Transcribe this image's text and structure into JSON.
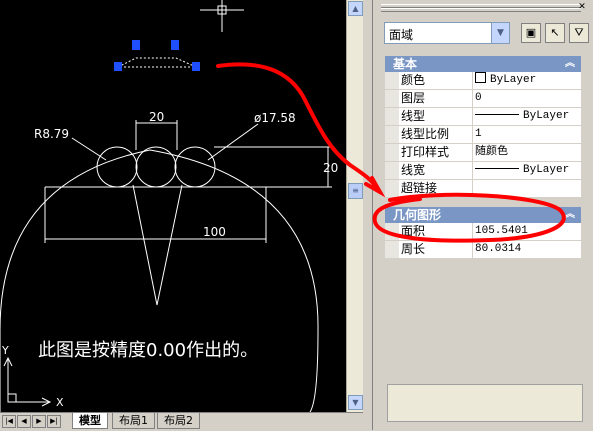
{
  "drawing": {
    "dims": {
      "radius": "R8.79",
      "diameter": "ø17.58",
      "width_top": "20",
      "height_right": "20",
      "width_bottom": "100"
    },
    "caption": "此图是按精度0.00作出的。",
    "ucs": {
      "y": "Y",
      "x": "X"
    }
  },
  "layout_tabs": [
    "模型",
    "布局1",
    "布局2"
  ],
  "properties": {
    "selected_type": "面域",
    "categories": [
      {
        "title": "基本",
        "rows": [
          {
            "key": "颜色",
            "value": "ByLayer",
            "swatch": true
          },
          {
            "key": "图层",
            "value": "0"
          },
          {
            "key": "线型",
            "value": "ByLayer",
            "line": true
          },
          {
            "key": "线型比例",
            "value": "1"
          },
          {
            "key": "打印样式",
            "value": "随颜色"
          },
          {
            "key": "线宽",
            "value": "ByLayer",
            "line": true
          },
          {
            "key": "超链接",
            "value": ""
          }
        ]
      },
      {
        "title": "几何图形",
        "rows": [
          {
            "key": "面积",
            "value": "105.5401"
          },
          {
            "key": "周长",
            "value": "80.0314"
          }
        ]
      }
    ]
  },
  "colors": {
    "annotation_red": "#ff0000",
    "category_blue": "#7a96c4",
    "canvas": "#000000"
  }
}
